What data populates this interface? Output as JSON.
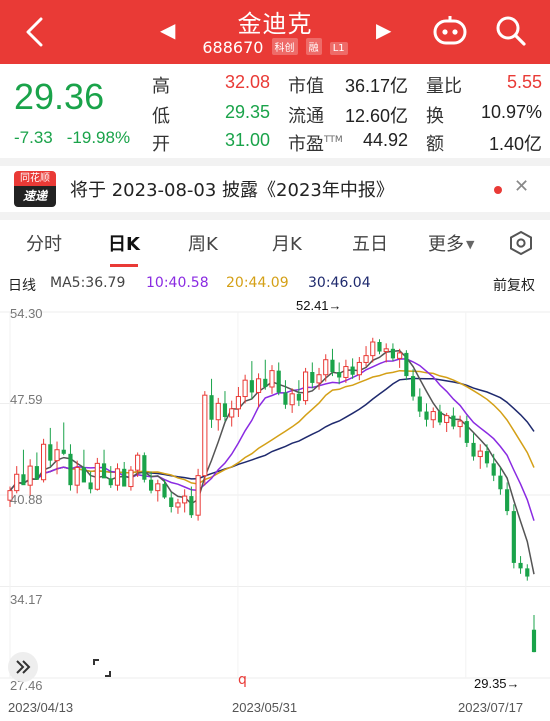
{
  "header": {
    "name": "金迪克",
    "code": "688670",
    "tags": [
      "科创",
      "融",
      "L1"
    ]
  },
  "quote": {
    "price": "29.36",
    "change": "-7.33",
    "change_pct": "-19.98%",
    "high_label": "高",
    "high": "32.08",
    "low_label": "低",
    "low": "29.35",
    "open_label": "开",
    "open": "31.00",
    "mcap_label": "市值",
    "mcap": "36.17亿",
    "float_label": "流通",
    "float": "12.60亿",
    "pe_label": "市盈",
    "pe_sup": "TTM",
    "pe": "44.92",
    "vr_label": "量比",
    "vr": "5.55",
    "turn_label": "换",
    "turn": "10.97%",
    "amt_label": "额",
    "amt": "1.40亿"
  },
  "notice": {
    "badge_top": "同花顺",
    "badge_bottom": "速递",
    "text": "将于 2023-08-03 披露《2023年中报》"
  },
  "tabs": [
    {
      "label": "分时"
    },
    {
      "label": "日K"
    },
    {
      "label": "周K"
    },
    {
      "label": "月K"
    },
    {
      "label": "五日"
    },
    {
      "label": "更多"
    }
  ],
  "ma": {
    "title": "日线",
    "ma5": "MA5:36.79",
    "ma10": "10:40.58",
    "ma20": "20:44.09",
    "ma30": "30:46.04",
    "adjust": "前复权"
  },
  "colors": {
    "up": "#e93a36",
    "down": "#1aa34a",
    "ma5": "#555555",
    "ma10": "#8a2be2",
    "ma20": "#d4a017",
    "ma30": "#1f2a6e"
  },
  "chart_data": {
    "type": "candlestick",
    "y_ticks": [
      "54.30",
      "47.59",
      "40.88",
      "34.17",
      "27.46"
    ],
    "ylim": [
      27.46,
      54.3
    ],
    "x_ticks": [
      "2023/04/13",
      "2023/05/31",
      "2023/07/17"
    ],
    "max_label": "52.41→",
    "min_label": "29.35→",
    "candles": [
      [
        40.5,
        41.5,
        40.0,
        41.2
      ],
      [
        41.2,
        43.0,
        41.0,
        42.4
      ],
      [
        42.4,
        44.2,
        42.0,
        41.6
      ],
      [
        41.6,
        43.5,
        40.8,
        43.0
      ],
      [
        43.0,
        44.0,
        42.6,
        42.0
      ],
      [
        42.0,
        45.0,
        41.8,
        44.6
      ],
      [
        44.6,
        45.8,
        43.0,
        43.4
      ],
      [
        43.4,
        44.8,
        42.4,
        44.2
      ],
      [
        44.2,
        46.2,
        43.8,
        43.9
      ],
      [
        43.9,
        44.6,
        41.2,
        41.6
      ],
      [
        41.6,
        43.4,
        41.0,
        42.9
      ],
      [
        42.9,
        44.2,
        42.2,
        41.8
      ],
      [
        41.8,
        42.6,
        41.0,
        41.3
      ],
      [
        41.3,
        43.6,
        41.2,
        43.2
      ],
      [
        43.2,
        44.2,
        42.6,
        42.1
      ],
      [
        42.1,
        43.0,
        41.4,
        41.6
      ],
      [
        41.6,
        43.2,
        41.2,
        42.8
      ],
      [
        42.8,
        43.3,
        41.6,
        41.5
      ],
      [
        41.5,
        43.0,
        41.2,
        42.7
      ],
      [
        42.7,
        44.0,
        42.2,
        43.8
      ],
      [
        43.8,
        44.0,
        41.8,
        42.0
      ],
      [
        42.0,
        42.6,
        41.0,
        41.2
      ],
      [
        41.2,
        42.0,
        40.4,
        41.7
      ],
      [
        41.7,
        42.0,
        40.6,
        40.7
      ],
      [
        40.7,
        41.1,
        39.6,
        40.0
      ],
      [
        40.0,
        40.6,
        39.5,
        40.3
      ],
      [
        40.3,
        41.3,
        39.6,
        40.8
      ],
      [
        40.8,
        41.5,
        39.2,
        39.4
      ],
      [
        39.4,
        42.8,
        39.0,
        42.3
      ],
      [
        42.3,
        48.5,
        41.6,
        48.2
      ],
      [
        48.2,
        49.4,
        45.8,
        46.4
      ],
      [
        46.4,
        48.0,
        45.6,
        47.6
      ],
      [
        47.6,
        48.5,
        46.3,
        46.6
      ],
      [
        46.6,
        47.8,
        45.9,
        47.2
      ],
      [
        47.2,
        48.8,
        46.6,
        48.1
      ],
      [
        48.1,
        49.7,
        47.6,
        49.3
      ],
      [
        49.3,
        50.7,
        47.9,
        48.4
      ],
      [
        48.4,
        49.8,
        47.3,
        49.4
      ],
      [
        49.4,
        50.8,
        48.6,
        48.8
      ],
      [
        48.8,
        50.4,
        48.3,
        50.0
      ],
      [
        50.0,
        50.6,
        48.2,
        48.4
      ],
      [
        48.4,
        49.3,
        47.2,
        47.5
      ],
      [
        47.5,
        48.7,
        46.9,
        48.3
      ],
      [
        48.3,
        49.3,
        47.4,
        47.8
      ],
      [
        47.8,
        50.2,
        47.5,
        49.9
      ],
      [
        49.9,
        50.6,
        48.7,
        49.1
      ],
      [
        49.1,
        50.2,
        48.6,
        49.7
      ],
      [
        49.7,
        51.2,
        49.2,
        50.8
      ],
      [
        50.8,
        51.6,
        49.6,
        49.9
      ],
      [
        49.9,
        50.6,
        49.0,
        49.5
      ],
      [
        49.5,
        50.8,
        49.1,
        50.3
      ],
      [
        50.3,
        50.9,
        49.4,
        49.7
      ],
      [
        49.7,
        51.0,
        49.3,
        50.6
      ],
      [
        50.6,
        51.8,
        50.3,
        51.1
      ],
      [
        51.1,
        52.41,
        50.6,
        52.1
      ],
      [
        52.1,
        52.3,
        51.2,
        51.4
      ],
      [
        51.4,
        52.0,
        50.6,
        51.6
      ],
      [
        51.6,
        52.0,
        50.7,
        50.9
      ],
      [
        50.9,
        51.6,
        50.2,
        51.3
      ],
      [
        51.3,
        51.5,
        49.3,
        49.6
      ],
      [
        49.6,
        50.1,
        47.8,
        48.1
      ],
      [
        48.1,
        48.7,
        46.6,
        47.0
      ],
      [
        47.0,
        47.6,
        45.9,
        46.4
      ],
      [
        46.4,
        47.3,
        45.8,
        47.0
      ],
      [
        47.0,
        47.5,
        46.0,
        46.2
      ],
      [
        46.2,
        46.9,
        45.5,
        46.7
      ],
      [
        46.7,
        47.3,
        45.7,
        45.9
      ],
      [
        45.9,
        46.7,
        45.1,
        46.3
      ],
      [
        46.3,
        46.7,
        44.4,
        44.7
      ],
      [
        44.7,
        45.4,
        43.4,
        43.7
      ],
      [
        43.7,
        44.6,
        42.8,
        44.1
      ],
      [
        44.1,
        44.6,
        42.9,
        43.2
      ],
      [
        43.2,
        43.9,
        41.9,
        42.3
      ],
      [
        42.3,
        42.9,
        40.9,
        41.3
      ],
      [
        41.3,
        41.8,
        39.4,
        39.7
      ],
      [
        39.7,
        40.2,
        35.5,
        35.9
      ],
      [
        35.9,
        36.4,
        35.1,
        35.5
      ],
      [
        35.5,
        35.8,
        34.6,
        34.9
      ],
      [
        31.0,
        32.08,
        29.35,
        29.36
      ]
    ]
  }
}
